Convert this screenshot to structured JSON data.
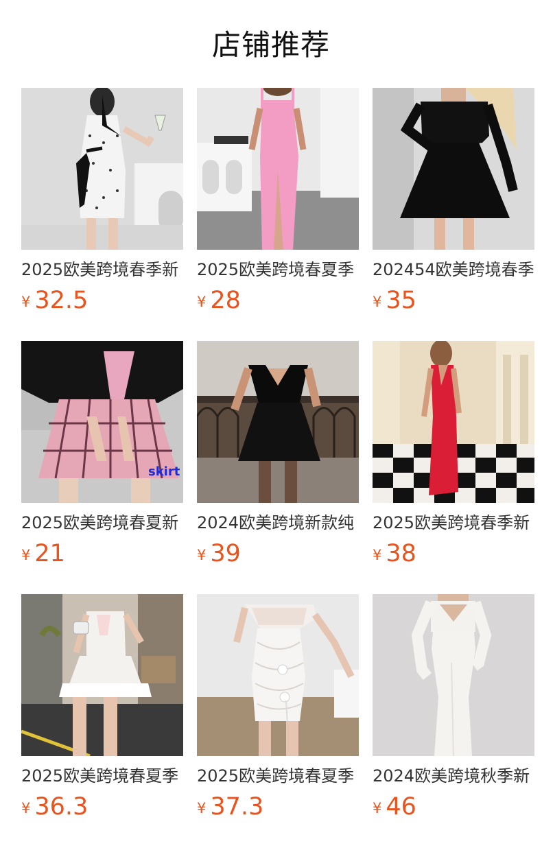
{
  "header": {
    "title": "店铺推荐"
  },
  "colors": {
    "price": "#e8531e",
    "title": "#111111",
    "name": "#333333"
  },
  "products": [
    {
      "name": "2025欧美跨境春季新",
      "currency": "¥",
      "price": "32.5",
      "image": "white-polka-dot-halter-dress-with-black-ribbons",
      "image_text": ""
    },
    {
      "name": "2025欧美跨境春夏季",
      "currency": "¥",
      "price": "28",
      "image": "pink-slip-maxi-dress",
      "image_text": ""
    },
    {
      "name": "202454欧美跨境春季",
      "currency": "¥",
      "price": "35",
      "image": "black-long-sleeve-skater-dress",
      "image_text": ""
    },
    {
      "name": "2025欧美跨境春夏新",
      "currency": "¥",
      "price": "21",
      "image": "pink-plaid-pleated-skirt",
      "image_text": "skirt"
    },
    {
      "name": "2024欧美跨境新款纯",
      "currency": "¥",
      "price": "39",
      "image": "black-off-shoulder-mini-dress",
      "image_text": ""
    },
    {
      "name": "2025欧美跨境春季新",
      "currency": "¥",
      "price": "38",
      "image": "red-halter-satin-maxi-dress",
      "image_text": ""
    },
    {
      "name": "2025欧美跨境春夏季",
      "currency": "¥",
      "price": "36.3",
      "image": "white-tiered-mini-dress",
      "image_text": ""
    },
    {
      "name": "2025欧美跨境春夏季",
      "currency": "¥",
      "price": "37.3",
      "image": "white-mesh-rosette-mini-dress",
      "image_text": ""
    },
    {
      "name": "2024欧美跨境秋季新",
      "currency": "¥",
      "price": "46",
      "image": "white-cutout-long-sleeve-maxi-dress",
      "image_text": ""
    }
  ]
}
